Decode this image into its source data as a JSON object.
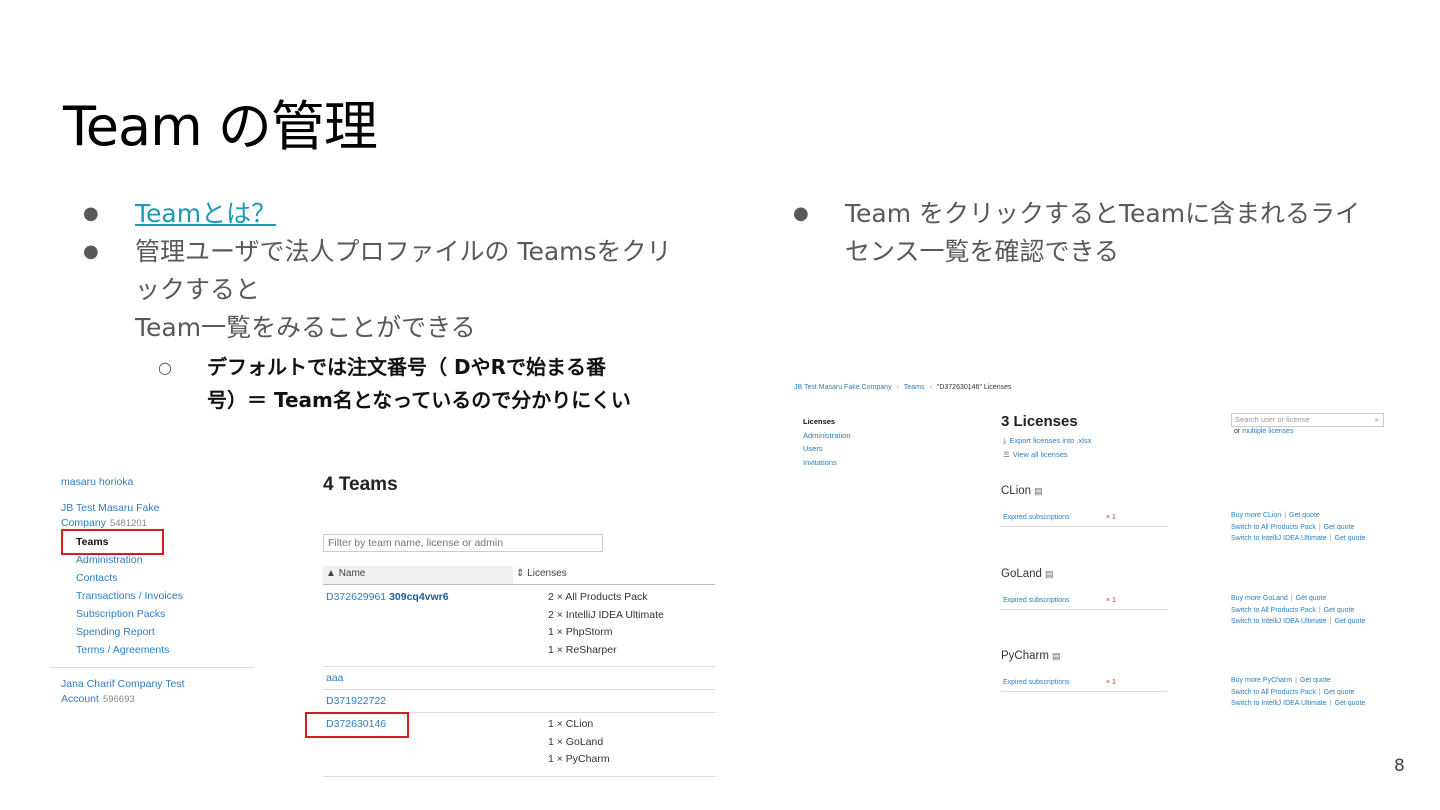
{
  "slide": {
    "title": "Team の管理",
    "page_number": "8"
  },
  "left_bullets": {
    "link_text": "Teamとは？",
    "bullet2": "管理ユーザで法人プロファイルの Teamsをクリックするとteam一覧をみることができる",
    "bullet2_text": "管理ユーザで法人プロファイルの Teamsをクリックすると",
    "bullet2_line2": "Team一覧をみることができる",
    "sub_line1": "デフォルトでは注文番号（ DやRで始まる番",
    "sub_line2": "号）＝ Team名となっているので分かりにくい"
  },
  "right_bullets": {
    "line1": "Team をクリックするとTeamに含まれるライ",
    "line2": "センス一覧を確認できる"
  },
  "teams_panel": {
    "sidebar": {
      "user": "masaru horioka",
      "company_name": "JB Test Masaru Fake Company",
      "company_id": "5481201",
      "items": [
        {
          "label": "Teams"
        },
        {
          "label": "Administration"
        },
        {
          "label": "Contacts"
        },
        {
          "label": "Transactions / Invoices"
        },
        {
          "label": "Subscription Packs"
        },
        {
          "label": "Spending Report"
        },
        {
          "label": "Terms / Agreements"
        }
      ],
      "company2_name": "Jana Charif Company Test Account",
      "company2_id": "596693"
    },
    "heading": "4 Teams",
    "filter_placeholder": "Filter by team name, license or admin",
    "columns": {
      "name": "Name",
      "licenses": "Licenses"
    },
    "rows": [
      {
        "id": "D372629961",
        "alias": "309cq4vwr6",
        "licenses": [
          "2 × All Products Pack",
          "2 × IntelliJ IDEA Ultimate",
          "1 × PhpStorm",
          "1 × ReSharper"
        ]
      },
      {
        "id": "aaa",
        "alias": "",
        "licenses": []
      },
      {
        "id": "D371922722",
        "alias": "",
        "licenses": []
      },
      {
        "id": "D372630146",
        "alias": "",
        "licenses": [
          "1 × CLion",
          "1 × GoLand",
          "1 × PyCharm"
        ]
      }
    ]
  },
  "licenses_panel": {
    "breadcrumb": [
      "JB Test Masaru Fake Company",
      "Teams",
      "\"D372630146\" Licenses"
    ],
    "nav": [
      {
        "label": "Licenses"
      },
      {
        "label": "Administration"
      },
      {
        "label": "Users"
      },
      {
        "label": "Invitations"
      }
    ],
    "heading": "3 Licenses",
    "export_link": "Export licenses into .xlsx",
    "view_all_link": "View all licenses",
    "search_placeholder": "Search user or license",
    "search_sub_prefix": "or",
    "search_sub_link": "multiple licenses",
    "products": [
      {
        "name": "CLion",
        "expired_label": "Expired subscriptions",
        "expired_count": "× 1",
        "buy_more": "Buy more CLion",
        "get_quote": "Get quote",
        "switch1": "Switch to All Products Pack",
        "switch2": "Switch to IntelliJ IDEA Ultimate"
      },
      {
        "name": "GoLand",
        "expired_label": "Expired subscriptions",
        "expired_count": "× 1",
        "buy_more": "Buy more GoLand",
        "get_quote": "Get quote",
        "switch1": "Switch to All Products Pack",
        "switch2": "Switch to IntelliJ IDEA Ultimate"
      },
      {
        "name": "PyCharm",
        "expired_label": "Expired subscriptions",
        "expired_count": "× 1",
        "buy_more": "Buy more PyCharm",
        "get_quote": "Get quote",
        "switch1": "Switch to All Products Pack",
        "switch2": "Switch to IntelliJ IDEA Ultimate"
      }
    ]
  },
  "colors": {
    "link": "#2d7fc1",
    "highlight_border": "#d41f1f",
    "slide_link": "#1a9bb3",
    "body_text": "#595959"
  }
}
